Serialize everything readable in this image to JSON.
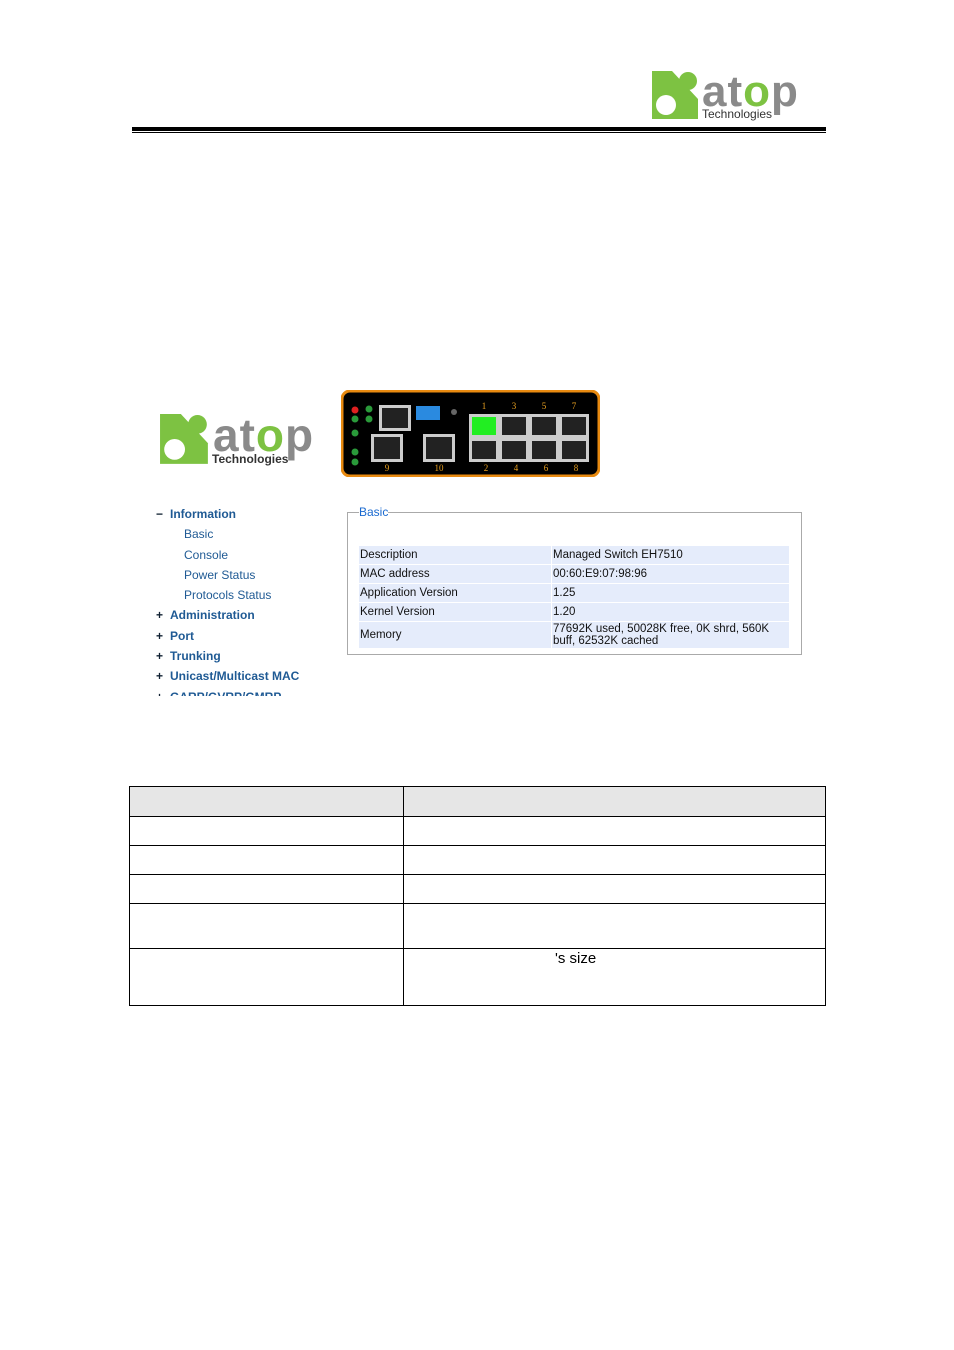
{
  "header_logo": {
    "brand": "atop",
    "tagline": "Technologies"
  },
  "screenshot": {
    "logo": {
      "brand": "atop",
      "tagline": "Technologies"
    },
    "device_panel": {
      "port_labels_top": [
        "1",
        "3",
        "5",
        "7"
      ],
      "port_labels_bottom": [
        "2",
        "4",
        "6",
        "8"
      ],
      "uplink_labels": [
        "9",
        "10"
      ],
      "active_port": "1",
      "colors": {
        "frame": "#e88a10",
        "body": "#000000",
        "active_port": "#22ee22",
        "led_green": "#2a9a3a",
        "led_red": "#e02020"
      }
    },
    "nav": {
      "items": [
        {
          "sign": "−",
          "label": "Information",
          "level": 0
        },
        {
          "label": "Basic",
          "level": 1
        },
        {
          "label": "Console",
          "level": 1
        },
        {
          "label": "Power Status",
          "level": 1
        },
        {
          "label": "Protocols Status",
          "level": 1
        },
        {
          "sign": "+",
          "label": "Administration",
          "level": 0
        },
        {
          "sign": "+",
          "label": "Port",
          "level": 0
        },
        {
          "sign": "+",
          "label": "Trunking",
          "level": 0
        },
        {
          "sign": "+",
          "label": "Unicast/Multicast MAC",
          "level": 0
        },
        {
          "sign": "+",
          "label": "GARP/GVRP/GMRP",
          "level": 0
        }
      ]
    },
    "basic": {
      "legend": "Basic",
      "rows": [
        {
          "label": "Description",
          "value": "Managed Switch EH7510"
        },
        {
          "label": "MAC address",
          "value": "00:60:E9:07:98:96"
        },
        {
          "label": "Application Version",
          "value": "1.25"
        },
        {
          "label": "Kernel Version",
          "value": "1.20"
        },
        {
          "label": "Memory",
          "value": "77692K used, 50028K free, 0K shrd, 560K buff, 62532K cached"
        }
      ]
    }
  },
  "doc_table": {
    "rows": [
      [
        "",
        ""
      ],
      [
        "",
        ""
      ],
      [
        "",
        ""
      ],
      [
        "",
        ""
      ],
      [
        "",
        ""
      ],
      [
        "",
        "'s size"
      ]
    ]
  }
}
